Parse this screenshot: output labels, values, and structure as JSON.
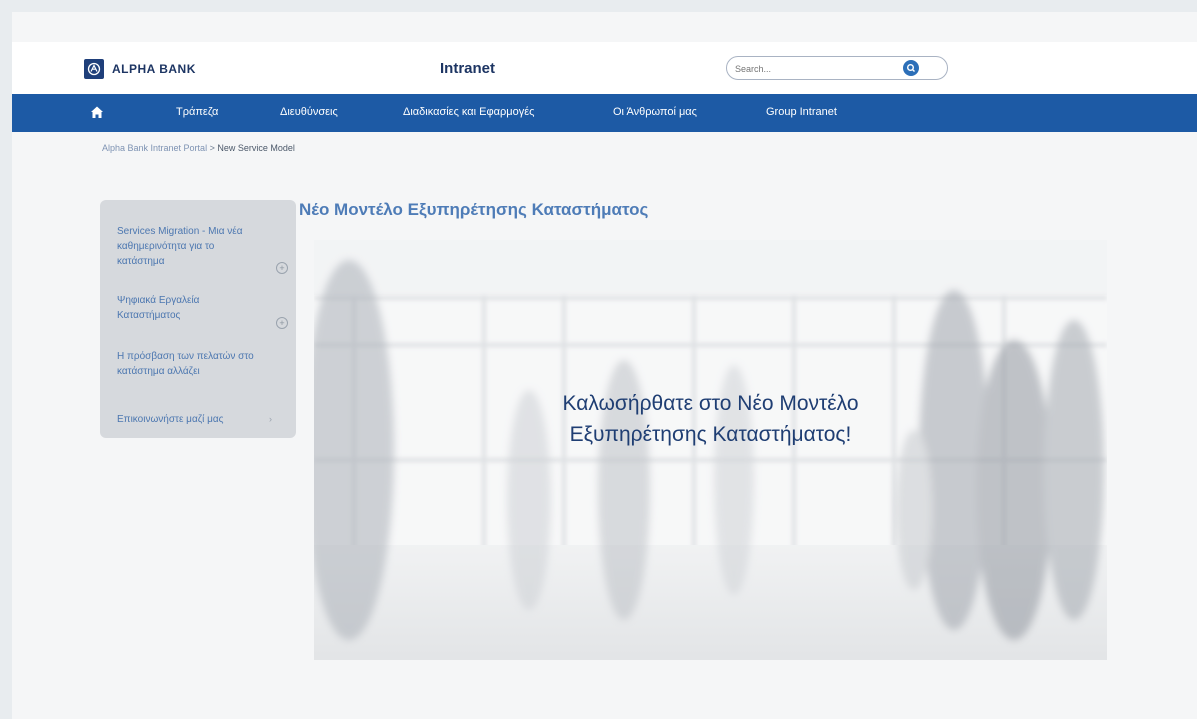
{
  "header": {
    "logo_text": "ALPHA BANK",
    "app_title": "Intranet",
    "search": {
      "placeholder": "Search...",
      "value": ""
    },
    "brand_color": "#1d3563",
    "nav_color": "#1d5aa5"
  },
  "nav": {
    "home_icon": "home-icon",
    "items": [
      {
        "label": "Τράπεζα"
      },
      {
        "label": "Διευθύνσεις"
      },
      {
        "label": "Διαδικασίες και Εφαρμογές"
      },
      {
        "label": "Οι Άνθρωποί μας"
      },
      {
        "label": "Group Intranet"
      }
    ]
  },
  "breadcrumb": {
    "root": "Alpha Bank Intranet Portal",
    "separator": " > ",
    "current": "New Service Model"
  },
  "sidebar": {
    "items": [
      {
        "label": "Services Migration - Μια νέα καθημερινότητα για το κατάστημα",
        "icon": "plus-circle-icon"
      },
      {
        "label": "Ψηφιακά Εργαλεία Καταστήματος",
        "icon": "plus-circle-icon"
      },
      {
        "label": "Η πρόσβαση των πελατών στο κατάστημα αλλάζει",
        "icon": ""
      },
      {
        "label": "Επικοινωνήστε μαζί μας",
        "icon": "chevron-right-icon"
      }
    ]
  },
  "main": {
    "title": "Νέο Μοντέλο Εξυπηρέτησης Καταστήματος",
    "hero": {
      "line1": "Καλωσήρθατε στο Νέο Μοντέλο",
      "line2": "Εξυπηρέτησης Καταστήματος!"
    }
  }
}
